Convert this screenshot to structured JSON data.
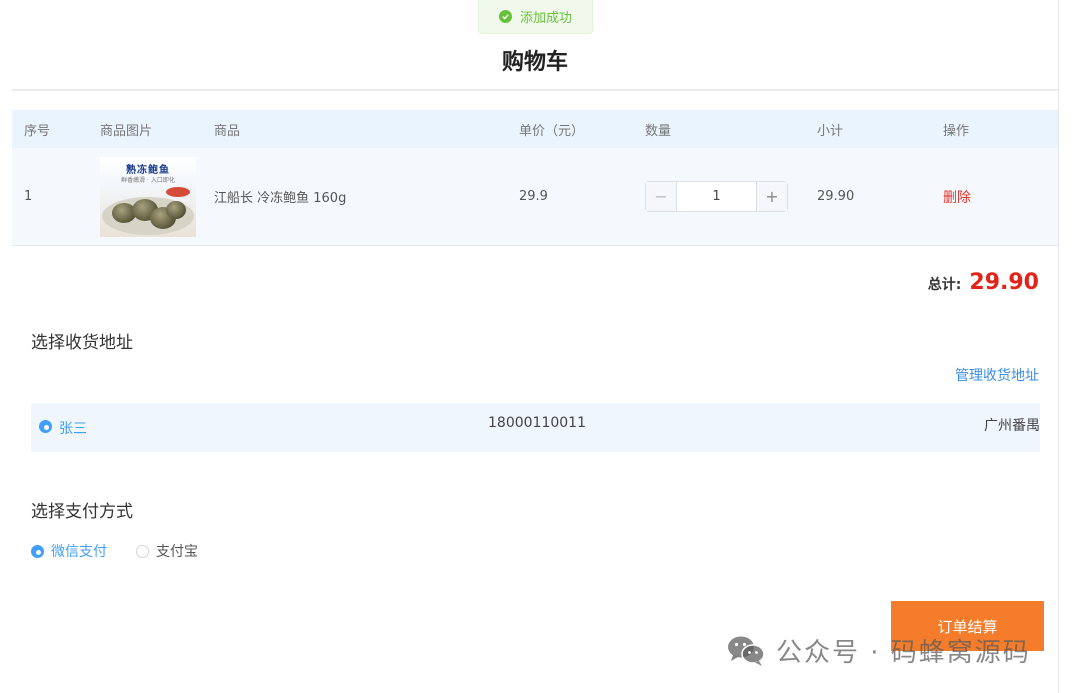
{
  "toast": {
    "message": "添加成功",
    "icon": "check-circle-icon"
  },
  "page": {
    "title": "购物车"
  },
  "cart": {
    "columns": [
      "序号",
      "商品图片",
      "商品",
      "单价（元）",
      "数量",
      "小计",
      "操作"
    ],
    "items": [
      {
        "index": "1",
        "image": {
          "title": "熟冻鲍鱼",
          "subtitle": "鲜香嫩滑 · 入口即化"
        },
        "name": "江船长 冷冻鲍鱼 160g",
        "price": "29.9",
        "quantity": "1",
        "subtotal": "29.90",
        "action": "删除"
      }
    ],
    "stepper": {
      "minus": "−",
      "plus": "+"
    }
  },
  "total": {
    "label": "总计:",
    "value": "29.90"
  },
  "address": {
    "title": "选择收货地址",
    "manage_label": "管理收货地址",
    "entries": [
      {
        "name": "张三",
        "phone": "18000110011",
        "city": "广州番禺",
        "selected": true
      }
    ]
  },
  "payment": {
    "title": "选择支付方式",
    "options": [
      {
        "label": "微信支付",
        "selected": true
      },
      {
        "label": "支付宝",
        "selected": false
      }
    ]
  },
  "checkout": {
    "label": "订单结算"
  },
  "watermark": {
    "text": "公众号 · 码蜂窝源码",
    "icon": "wechat-icon"
  },
  "colors": {
    "accent": "#409eff",
    "price_red": "#e2231a",
    "delete_red": "#e6332a",
    "checkout_orange": "#f47c2a",
    "success_green": "#67c23a",
    "header_bg": "#eaf4fe"
  }
}
